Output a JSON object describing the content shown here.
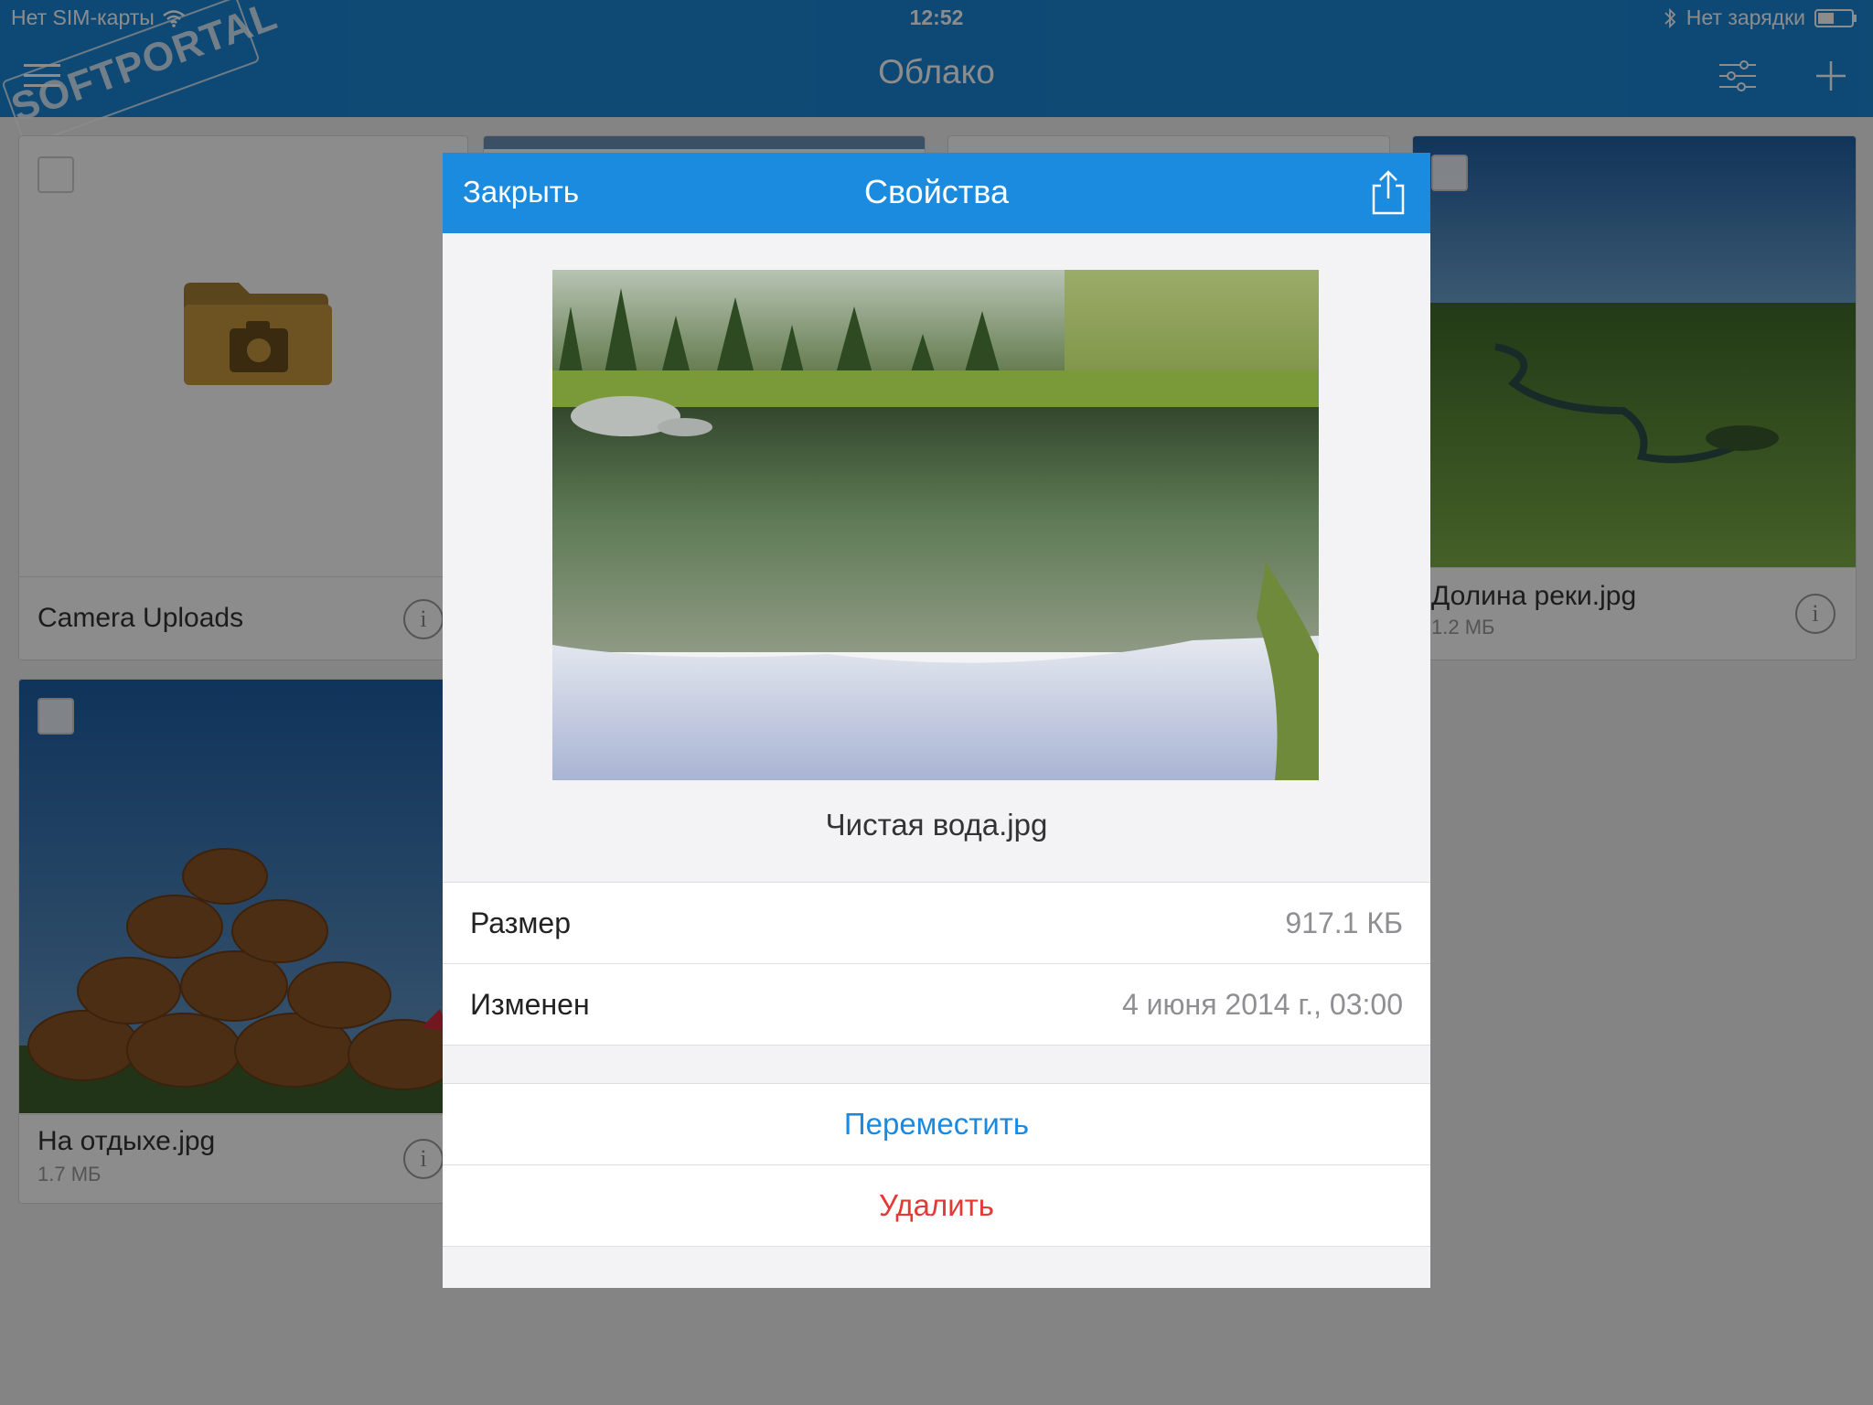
{
  "status_bar": {
    "carrier": "Нет SIM-карты",
    "time": "12:52",
    "charging": "Нет зарядки"
  },
  "nav": {
    "title": "Облако",
    "icons": [
      "menu-icon",
      "filter-icon",
      "add-icon"
    ]
  },
  "watermark": {
    "text": "SOFTPORTAL"
  },
  "grid": {
    "items": [
      {
        "name": "Camera Uploads",
        "size": "",
        "type": "folder"
      },
      {
        "name": "Долина реки.jpg",
        "size": "1.2 МБ",
        "type": "image"
      },
      {
        "name": "На отдыхе.jpg",
        "size": "1.7 МБ",
        "type": "image"
      }
    ]
  },
  "modal": {
    "close_label": "Закрыть",
    "title": "Свойства",
    "file_name": "Чистая вода.jpg",
    "properties": [
      {
        "label": "Размер",
        "value": "917.1 КБ"
      },
      {
        "label": "Изменен",
        "value": "4 июня 2014 г., 03:00"
      }
    ],
    "move_label": "Переместить",
    "delete_label": "Удалить"
  },
  "colors": {
    "header_blue": "#1b86d6",
    "action_blue": "#1a8ae0",
    "delete_red": "#e53935",
    "folder_brown": "#c9983f"
  }
}
